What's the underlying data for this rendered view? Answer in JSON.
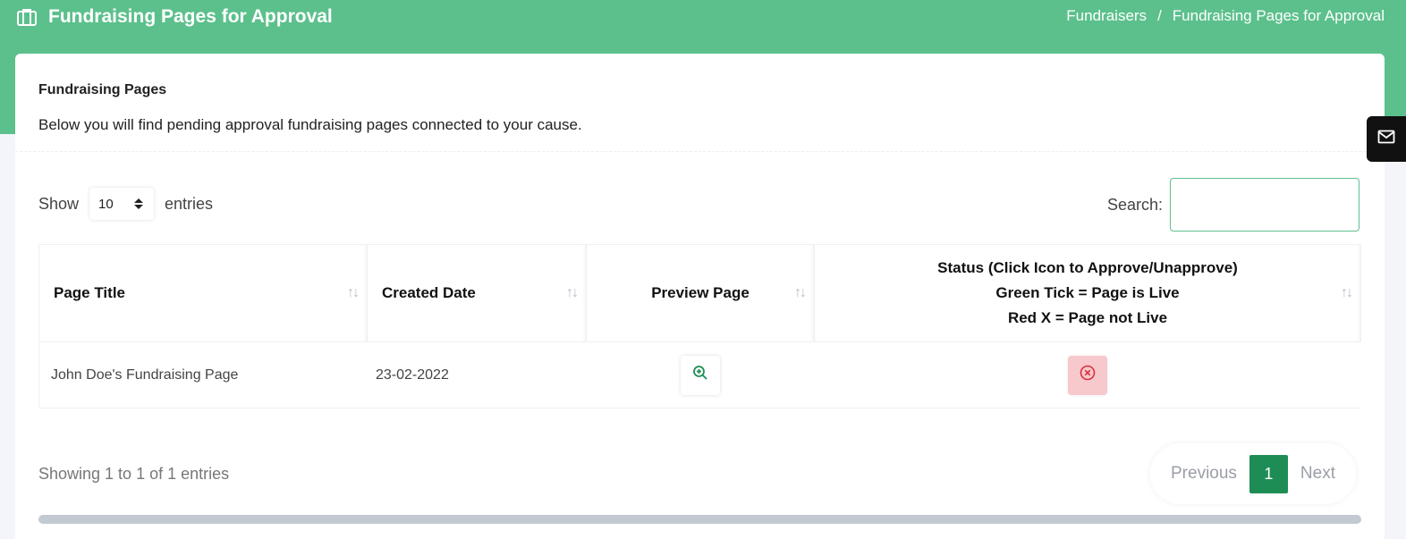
{
  "header": {
    "title": "Fundraising Pages for Approval",
    "title_icon": "briefcase-icon",
    "breadcrumb": {
      "items": [
        "Fundraisers",
        "Fundraising Pages for Approval"
      ],
      "separator": "/"
    }
  },
  "card": {
    "title": "Fundraising Pages",
    "description": "Below you will find pending approval fundraising pages connected to your cause."
  },
  "controls": {
    "show_label": "Show",
    "entries_value": "10",
    "entries_label": "entries",
    "search_label": "Search:",
    "search_value": ""
  },
  "table": {
    "columns": {
      "page_title": "Page Title",
      "created_date": "Created Date",
      "preview_page": "Preview Page",
      "status_line1": "Status (Click Icon to Approve/Unapprove)",
      "status_line2": "Green Tick = Page is Live",
      "status_line3": "Red X = Page not Live"
    },
    "rows": [
      {
        "page_title": "John Doe's Fundraising Page",
        "created_date": "23-02-2022",
        "preview_icon": "zoom-in-icon",
        "status_icon": "x-circle-icon",
        "status": "not live"
      }
    ]
  },
  "footer": {
    "info": "Showing 1 to 1 of 1 entries",
    "pagination": {
      "previous": "Previous",
      "current": "1",
      "next": "Next"
    }
  },
  "colors": {
    "brand_green": "#5cc08c",
    "active_page": "#1e8d55",
    "status_bg": "#f7c9cc",
    "status_icon": "#d9303c"
  },
  "side_tab": {
    "icon": "mail-icon"
  }
}
